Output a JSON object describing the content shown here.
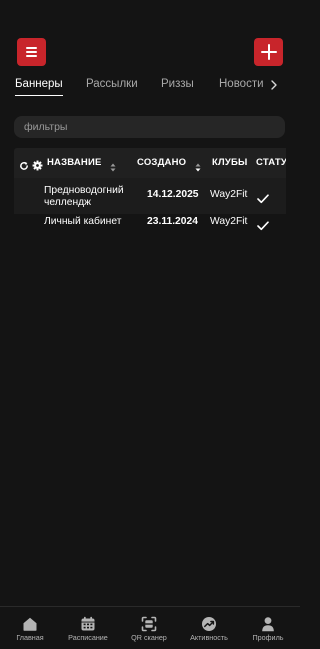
{
  "header": {
    "menu_icon": "hamburger-icon",
    "add_icon": "plus-icon",
    "accent": "#c8252b"
  },
  "tabs": [
    {
      "label": "Баннеры",
      "active": true
    },
    {
      "label": "Рассылки",
      "active": false
    },
    {
      "label": "Риззы",
      "active": false
    },
    {
      "label": "Новости",
      "active": false
    }
  ],
  "search": {
    "placeholder": "фильтры"
  },
  "table": {
    "columns": {
      "name": "НАЗВАНИЕ",
      "created": "СОЗДАНО",
      "clubs": "КЛУБЫ",
      "status": "СТАТУС"
    },
    "rows": [
      {
        "name_line1": "Предноводогний",
        "name_line2": "челлендж",
        "created": "14.12.2025",
        "clubs": "Way2Fit",
        "status": "check-icon"
      },
      {
        "name_line1": "Личный кабинет",
        "name_line2": "",
        "created": "23.11.2024",
        "clubs": "Way2Fit",
        "status": "check-icon"
      }
    ]
  },
  "bottom_nav": [
    {
      "label": "Главная",
      "icon": "home-icon"
    },
    {
      "label": "Расписание",
      "icon": "calendar-icon"
    },
    {
      "label": "QR сканер",
      "icon": "qr-scanner-icon"
    },
    {
      "label": "Активность",
      "icon": "activity-icon"
    },
    {
      "label": "Профиль",
      "icon": "profile-icon"
    }
  ]
}
